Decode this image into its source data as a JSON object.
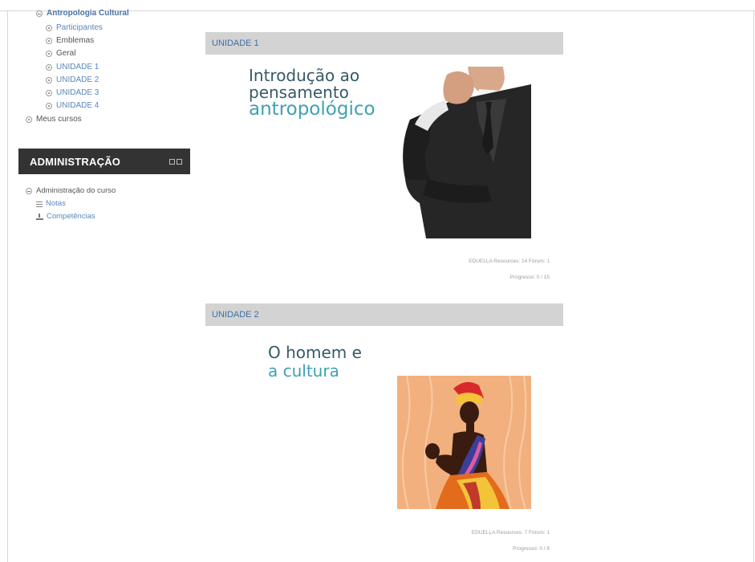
{
  "sidebar": {
    "course": "Antropologia Cultural",
    "items": [
      {
        "label": "Participantes",
        "style": "link"
      },
      {
        "label": "Emblemas",
        "style": "dark"
      },
      {
        "label": "Geral",
        "style": "dark"
      },
      {
        "label": "UNIDADE 1",
        "style": "link"
      },
      {
        "label": "UNIDADE 2",
        "style": "link"
      },
      {
        "label": "UNIDADE 3",
        "style": "link"
      },
      {
        "label": "UNIDADE 4",
        "style": "link"
      }
    ],
    "my_courses": "Meus cursos"
  },
  "admin": {
    "title": "ADMINISTRAÇÃO",
    "course_admin": "Administração do curso",
    "notes": "Notas",
    "competencies": "Competências"
  },
  "units": [
    {
      "header": "UNIDADE 1",
      "title_line1": "Introdução ao",
      "title_line2": "pensamento",
      "title_line3": "antropológico",
      "meta_line1": "EDUELLA Resources: 14 Fórum: 1",
      "meta_line2": "Progresso: 0 / 15",
      "image": "businessman-thinking-image"
    },
    {
      "header": "UNIDADE 2",
      "title_line1": "O homem e",
      "title_line2": "a cultura",
      "meta_line1": "EDUELLA Resources: 7 Fórum: 1",
      "meta_line2": "Progresso: 0 / 8",
      "image": "african-woman-with-child-illustration"
    }
  ],
  "colors": {
    "link": "#5a86b8",
    "admin_bg": "#333333",
    "unit_bar": "#d3d3d3",
    "teal": "#3fa0b6"
  }
}
